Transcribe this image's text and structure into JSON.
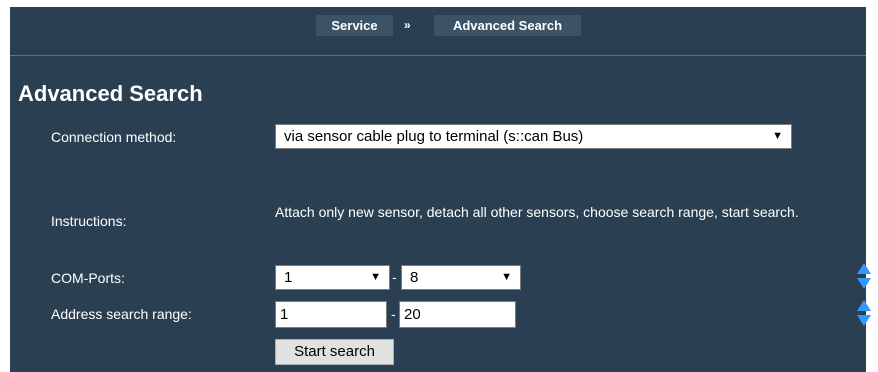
{
  "breadcrumb": {
    "items": [
      {
        "label": "Service"
      },
      {
        "label": "Advanced Search"
      }
    ],
    "separator": "»"
  },
  "page": {
    "title": "Advanced Search"
  },
  "form": {
    "connection_method": {
      "label": "Connection method:",
      "value": "via sensor cable plug to terminal (s::can Bus)"
    },
    "instructions": {
      "label": "Instructions:",
      "text": "Attach only new sensor, detach all other sensors, choose search range, start search."
    },
    "com_ports": {
      "label": "COM-Ports:",
      "from": "1",
      "to": "8",
      "dash": "-"
    },
    "address_range": {
      "label": "Address search range:",
      "from": "1",
      "to": "20",
      "dash": "-"
    },
    "start_button": "Start search"
  },
  "icons": {
    "dropdown": "dropdown-arrow-icon",
    "spinner": "spinner-arrows-icon"
  },
  "colors": {
    "panel_bg": "#2b3f52",
    "crumb_bg": "#3c5265",
    "spinner_accent": "#3399ff"
  }
}
